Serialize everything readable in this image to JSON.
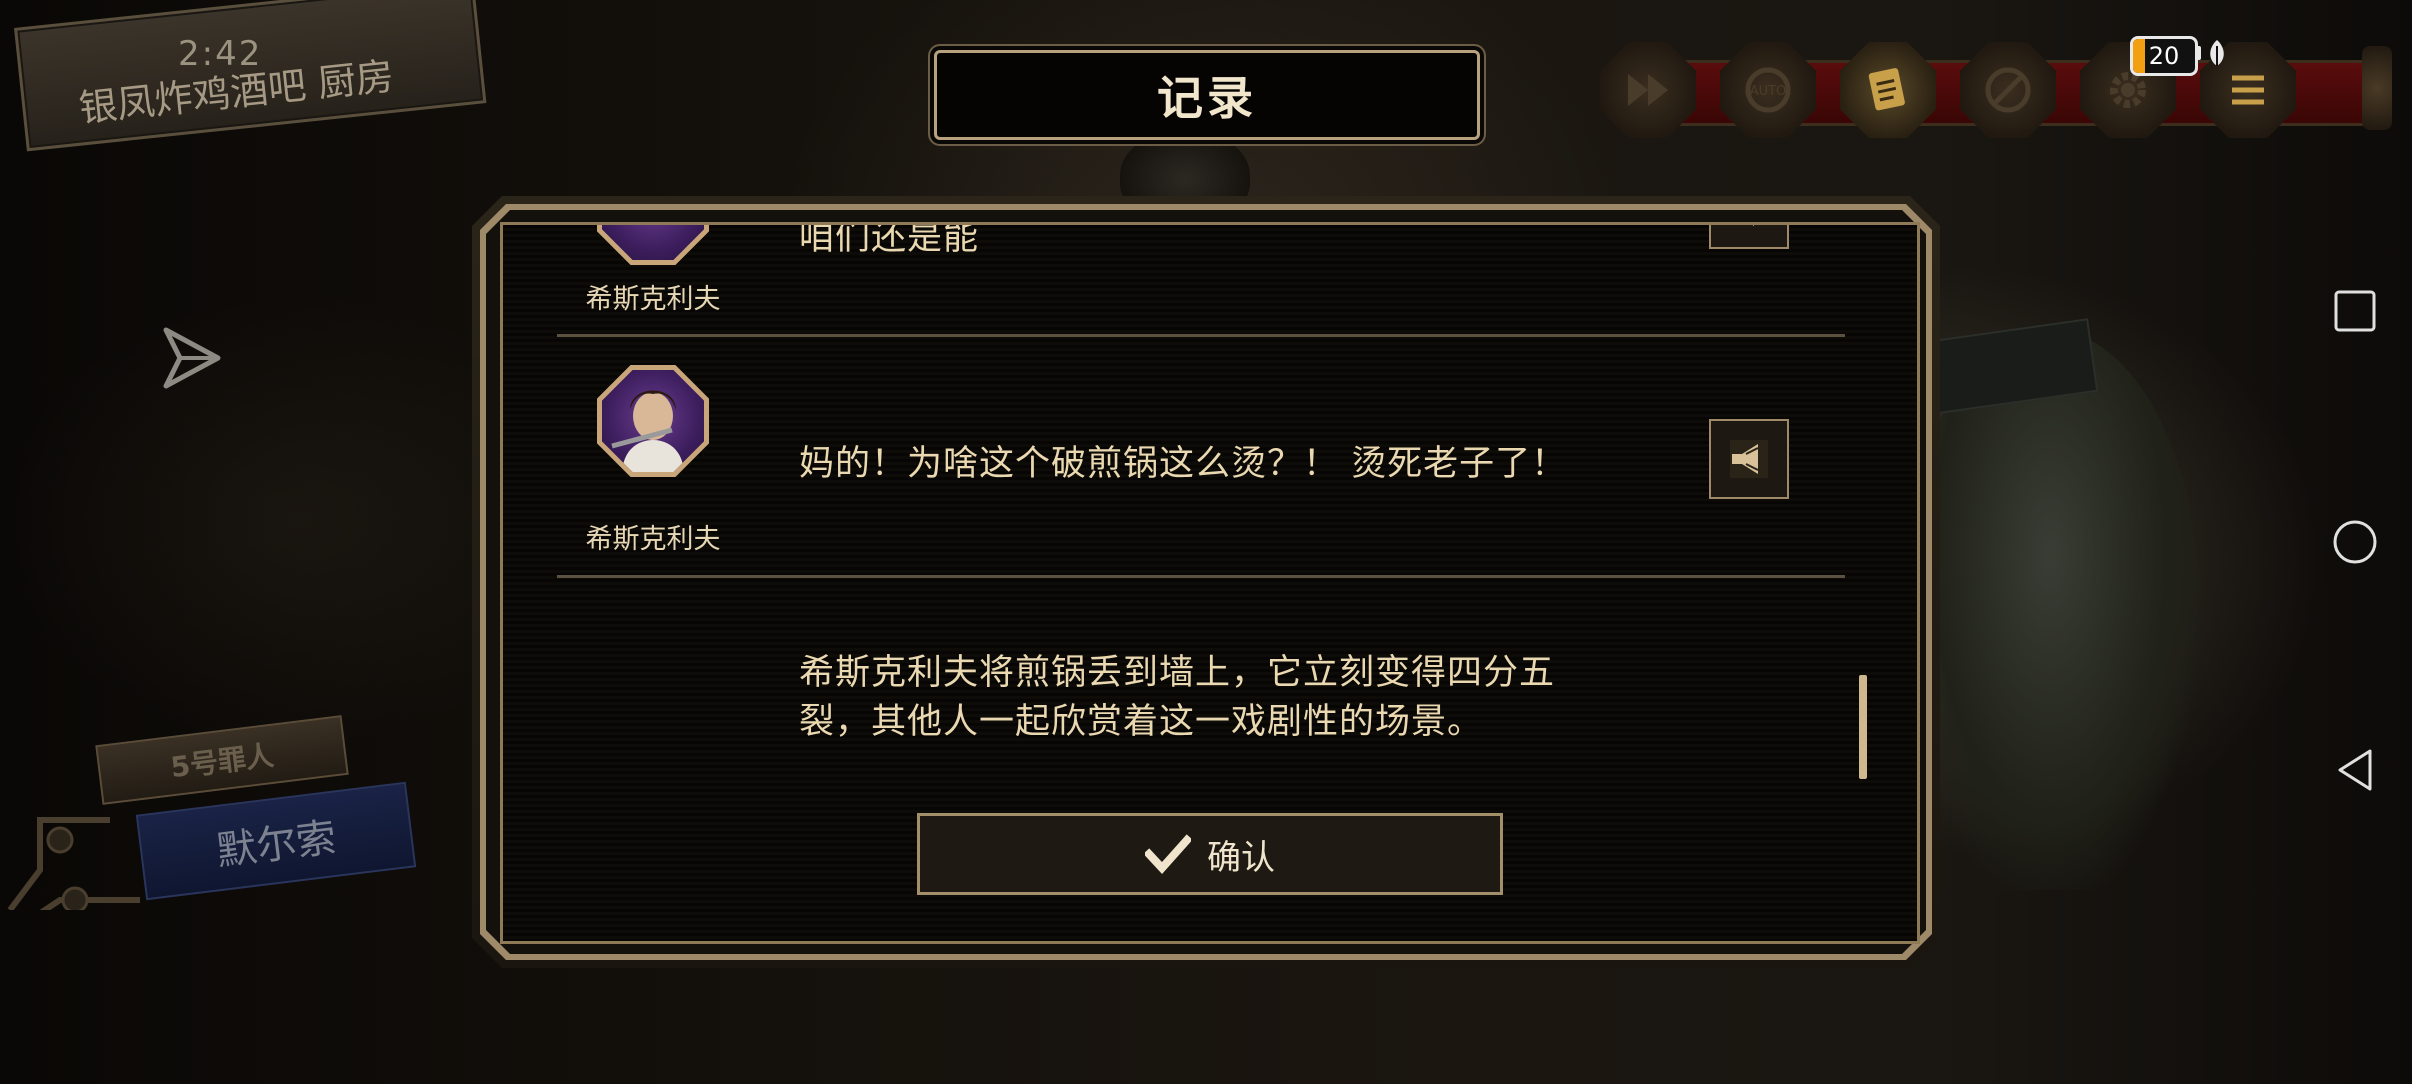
{
  "location": {
    "clock": "2:42",
    "name": "银凤炸鸡酒吧 厨房"
  },
  "title": "记录",
  "toolbar": {
    "buttons": [
      {
        "icon": "fast-forward-icon",
        "active": false
      },
      {
        "icon": "auto-icon",
        "label": "AUTO",
        "active": false
      },
      {
        "icon": "log-icon",
        "active": true
      },
      {
        "icon": "hide-ui-icon",
        "active": false
      },
      {
        "icon": "settings-gear-icon",
        "active": false
      },
      {
        "icon": "menu-icon",
        "active": false
      }
    ]
  },
  "status": {
    "battery_level": "20",
    "battery_fraction": 0.2,
    "battery_color": "#f2a012"
  },
  "character_badge": {
    "number_label": "5号罪人",
    "name": "默尔索"
  },
  "log": {
    "entries": [
      {
        "speaker": "希斯克利夫",
        "text": "咱们还是能",
        "has_voice": true,
        "partial": true
      },
      {
        "speaker": "希斯克利夫",
        "text": "妈的！为啥这个破煎锅这么烫？！ 烫死老子了！",
        "has_voice": true
      }
    ],
    "narration": "希斯克利夫将煎锅丢到墙上，它立刻变得四分五裂，其他人一起欣赏着这一戏剧性的场景。",
    "narration_lines": [
      "希斯克利夫将煎锅丢到墙上，它立刻变得四分五",
      "裂，其他人一起欣赏着这一戏剧性的场景。"
    ]
  },
  "confirm_label": "确认",
  "system_nav": [
    "recent-apps-icon",
    "home-icon",
    "back-icon"
  ],
  "colors": {
    "accent_gold": "#b7a27d",
    "toolbar_red": "#5a0c0c",
    "badge_blue": "#1a2346"
  }
}
